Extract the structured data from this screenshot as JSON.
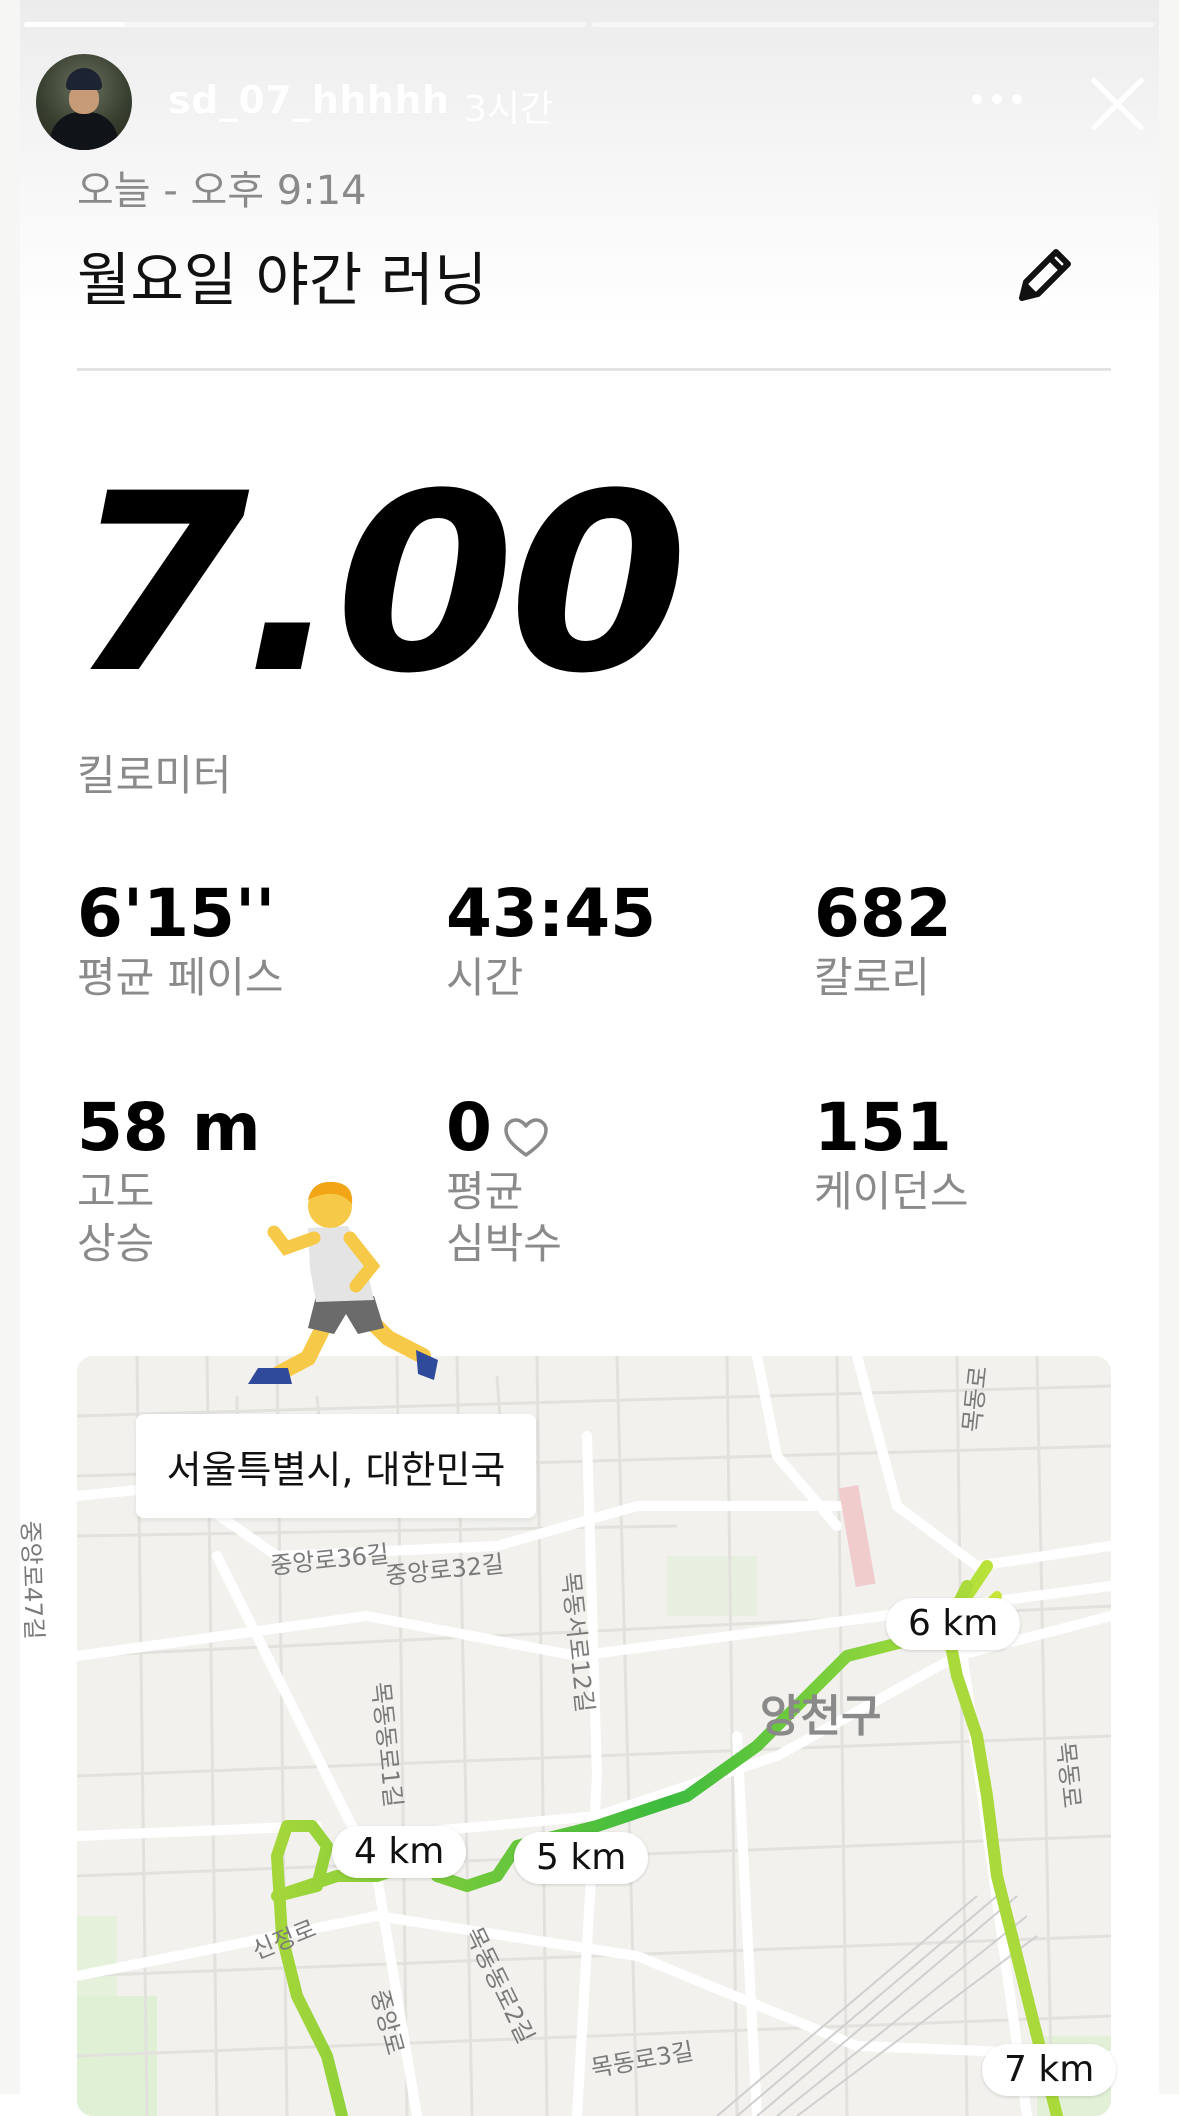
{
  "story": {
    "username": "sd_07_hhhhh",
    "time_ago": "3시간",
    "progress": [
      0.18,
      0.0
    ]
  },
  "activity": {
    "date": "오늘 - 오후 9:14",
    "title": "월요일 야간 러닝",
    "distance": "7.00",
    "distance_unit": "킬로미터"
  },
  "stats": {
    "pace": {
      "value": "6'15''",
      "label": "평균 페이스"
    },
    "time": {
      "value": "43:45",
      "label": "시간"
    },
    "calories": {
      "value": "682",
      "label": "칼로리"
    },
    "elevation": {
      "value": "58 m",
      "label1": "고도",
      "label2": "상승"
    },
    "heart_rate": {
      "value": "0",
      "label1": "평균",
      "label2": "심박수"
    },
    "cadence": {
      "value": "151",
      "label": "케이던스"
    }
  },
  "map": {
    "location": "서울특별시, 대한민국",
    "district": "양천구",
    "km_markers": [
      "4 km",
      "5 km",
      "6 km",
      "7 km"
    ],
    "streets": {
      "s1": "중앙로36길",
      "s2": "중앙로32길",
      "s3": "중앙로47길",
      "s4": "목동서로12길",
      "s5": "목동동로1길",
      "s6": "목동동로2길",
      "s7": "신정로",
      "s8": "중앙로",
      "s9": "목동로3길",
      "s10": "목동로",
      "s11": "목동로"
    }
  },
  "icons": {
    "more": "more-dots-icon",
    "close": "close-icon",
    "edit": "pencil-icon",
    "heart": "heart-outline-icon",
    "runner": "runner-emoji"
  }
}
